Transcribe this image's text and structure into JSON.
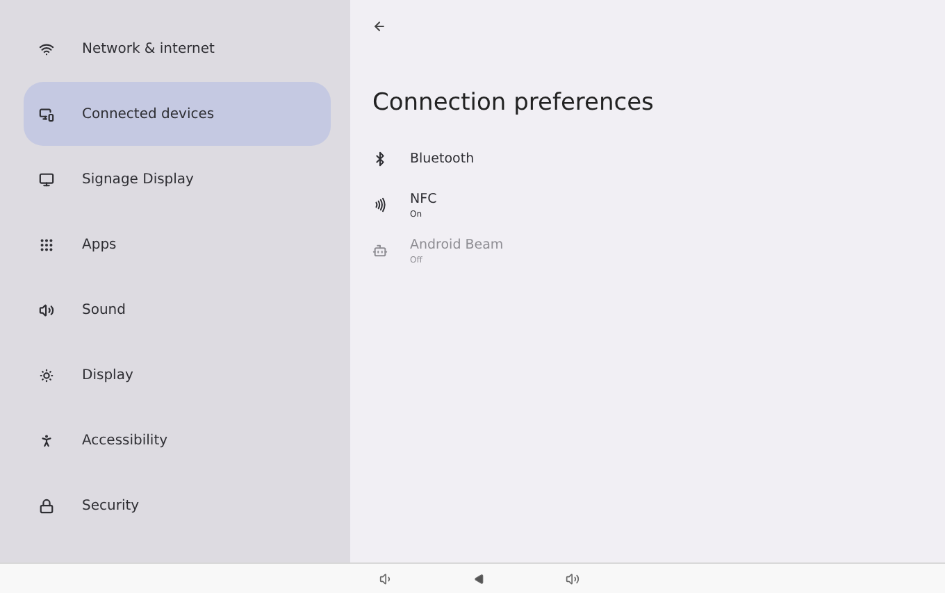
{
  "sidebar": {
    "items": [
      {
        "label": "Network & internet",
        "selected": false
      },
      {
        "label": "Connected devices",
        "selected": true
      },
      {
        "label": "Signage Display",
        "selected": false
      },
      {
        "label": "Apps",
        "selected": false
      },
      {
        "label": "Sound",
        "selected": false
      },
      {
        "label": "Display",
        "selected": false
      },
      {
        "label": "Accessibility",
        "selected": false
      },
      {
        "label": "Security",
        "selected": false
      }
    ]
  },
  "page": {
    "title": "Connection preferences",
    "items": [
      {
        "title": "Bluetooth",
        "disabled": false
      },
      {
        "title": "NFC",
        "summary": "On",
        "disabled": false
      },
      {
        "title": "Android Beam",
        "summary": "Off",
        "disabled": true
      }
    ]
  }
}
